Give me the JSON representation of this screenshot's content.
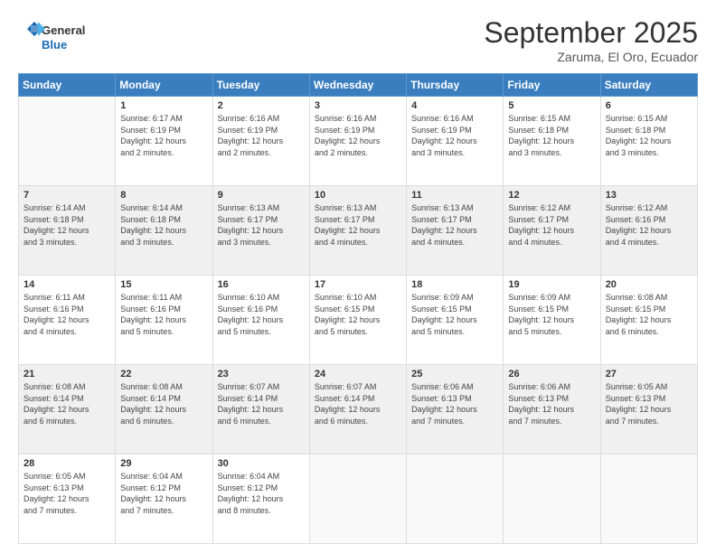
{
  "logo": {
    "general": "General",
    "blue": "Blue"
  },
  "header": {
    "month": "September 2025",
    "location": "Zaruma, El Oro, Ecuador"
  },
  "days_of_week": [
    "Sunday",
    "Monday",
    "Tuesday",
    "Wednesday",
    "Thursday",
    "Friday",
    "Saturday"
  ],
  "weeks": [
    [
      {
        "day": "",
        "info": ""
      },
      {
        "day": "1",
        "info": "Sunrise: 6:17 AM\nSunset: 6:19 PM\nDaylight: 12 hours\nand 2 minutes."
      },
      {
        "day": "2",
        "info": "Sunrise: 6:16 AM\nSunset: 6:19 PM\nDaylight: 12 hours\nand 2 minutes."
      },
      {
        "day": "3",
        "info": "Sunrise: 6:16 AM\nSunset: 6:19 PM\nDaylight: 12 hours\nand 2 minutes."
      },
      {
        "day": "4",
        "info": "Sunrise: 6:16 AM\nSunset: 6:19 PM\nDaylight: 12 hours\nand 3 minutes."
      },
      {
        "day": "5",
        "info": "Sunrise: 6:15 AM\nSunset: 6:18 PM\nDaylight: 12 hours\nand 3 minutes."
      },
      {
        "day": "6",
        "info": "Sunrise: 6:15 AM\nSunset: 6:18 PM\nDaylight: 12 hours\nand 3 minutes."
      }
    ],
    [
      {
        "day": "7",
        "info": "Sunrise: 6:14 AM\nSunset: 6:18 PM\nDaylight: 12 hours\nand 3 minutes."
      },
      {
        "day": "8",
        "info": "Sunrise: 6:14 AM\nSunset: 6:18 PM\nDaylight: 12 hours\nand 3 minutes."
      },
      {
        "day": "9",
        "info": "Sunrise: 6:13 AM\nSunset: 6:17 PM\nDaylight: 12 hours\nand 3 minutes."
      },
      {
        "day": "10",
        "info": "Sunrise: 6:13 AM\nSunset: 6:17 PM\nDaylight: 12 hours\nand 4 minutes."
      },
      {
        "day": "11",
        "info": "Sunrise: 6:13 AM\nSunset: 6:17 PM\nDaylight: 12 hours\nand 4 minutes."
      },
      {
        "day": "12",
        "info": "Sunrise: 6:12 AM\nSunset: 6:17 PM\nDaylight: 12 hours\nand 4 minutes."
      },
      {
        "day": "13",
        "info": "Sunrise: 6:12 AM\nSunset: 6:16 PM\nDaylight: 12 hours\nand 4 minutes."
      }
    ],
    [
      {
        "day": "14",
        "info": "Sunrise: 6:11 AM\nSunset: 6:16 PM\nDaylight: 12 hours\nand 4 minutes."
      },
      {
        "day": "15",
        "info": "Sunrise: 6:11 AM\nSunset: 6:16 PM\nDaylight: 12 hours\nand 5 minutes."
      },
      {
        "day": "16",
        "info": "Sunrise: 6:10 AM\nSunset: 6:16 PM\nDaylight: 12 hours\nand 5 minutes."
      },
      {
        "day": "17",
        "info": "Sunrise: 6:10 AM\nSunset: 6:15 PM\nDaylight: 12 hours\nand 5 minutes."
      },
      {
        "day": "18",
        "info": "Sunrise: 6:09 AM\nSunset: 6:15 PM\nDaylight: 12 hours\nand 5 minutes."
      },
      {
        "day": "19",
        "info": "Sunrise: 6:09 AM\nSunset: 6:15 PM\nDaylight: 12 hours\nand 5 minutes."
      },
      {
        "day": "20",
        "info": "Sunrise: 6:08 AM\nSunset: 6:15 PM\nDaylight: 12 hours\nand 6 minutes."
      }
    ],
    [
      {
        "day": "21",
        "info": "Sunrise: 6:08 AM\nSunset: 6:14 PM\nDaylight: 12 hours\nand 6 minutes."
      },
      {
        "day": "22",
        "info": "Sunrise: 6:08 AM\nSunset: 6:14 PM\nDaylight: 12 hours\nand 6 minutes."
      },
      {
        "day": "23",
        "info": "Sunrise: 6:07 AM\nSunset: 6:14 PM\nDaylight: 12 hours\nand 6 minutes."
      },
      {
        "day": "24",
        "info": "Sunrise: 6:07 AM\nSunset: 6:14 PM\nDaylight: 12 hours\nand 6 minutes."
      },
      {
        "day": "25",
        "info": "Sunrise: 6:06 AM\nSunset: 6:13 PM\nDaylight: 12 hours\nand 7 minutes."
      },
      {
        "day": "26",
        "info": "Sunrise: 6:06 AM\nSunset: 6:13 PM\nDaylight: 12 hours\nand 7 minutes."
      },
      {
        "day": "27",
        "info": "Sunrise: 6:05 AM\nSunset: 6:13 PM\nDaylight: 12 hours\nand 7 minutes."
      }
    ],
    [
      {
        "day": "28",
        "info": "Sunrise: 6:05 AM\nSunset: 6:13 PM\nDaylight: 12 hours\nand 7 minutes."
      },
      {
        "day": "29",
        "info": "Sunrise: 6:04 AM\nSunset: 6:12 PM\nDaylight: 12 hours\nand 7 minutes."
      },
      {
        "day": "30",
        "info": "Sunrise: 6:04 AM\nSunset: 6:12 PM\nDaylight: 12 hours\nand 8 minutes."
      },
      {
        "day": "",
        "info": ""
      },
      {
        "day": "",
        "info": ""
      },
      {
        "day": "",
        "info": ""
      },
      {
        "day": "",
        "info": ""
      }
    ]
  ]
}
